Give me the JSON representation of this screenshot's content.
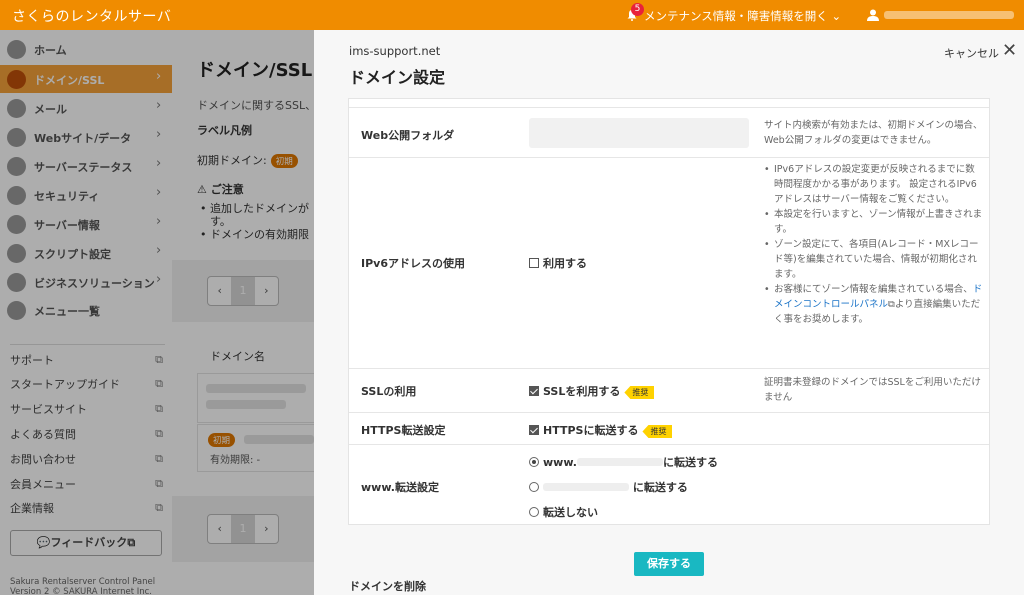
{
  "topbar": {
    "brand": "さくらのレンタルサーバ",
    "notification_count": "5",
    "maintenance_label": "メンテナンス情報・障害情報を開く"
  },
  "sidebar": {
    "items": [
      {
        "label": "ホーム",
        "icon": "home-icon"
      },
      {
        "label": "ドメイン/SSL",
        "icon": "domain-icon"
      },
      {
        "label": "メール",
        "icon": "mail-icon"
      },
      {
        "label": "Webサイト/データ",
        "icon": "globe-icon"
      },
      {
        "label": "サーバーステータス",
        "icon": "chart-icon"
      },
      {
        "label": "セキュリティ",
        "icon": "lock-icon"
      },
      {
        "label": "サーバー情報",
        "icon": "server-icon"
      },
      {
        "label": "スクリプト設定",
        "icon": "script-icon"
      },
      {
        "label": "ビジネスソリューション",
        "icon": "gear-icon"
      },
      {
        "label": "メニュー一覧",
        "icon": "list-icon"
      }
    ],
    "links": [
      "サポート",
      "スタートアップガイド",
      "サービスサイト",
      "よくある質問",
      "お問い合わせ",
      "会員メニュー",
      "企業情報"
    ],
    "feedback_label": "フィードバック",
    "footer_line1": "Sakura Rentalserver Control Panel",
    "footer_line2": "Version 2 © SAKURA Internet Inc."
  },
  "main": {
    "title": "ドメイン/SSL",
    "desc": "ドメインに関するSSL、",
    "legend_title": "ラベル凡例",
    "legend_initial_label": "初期ドメイン:",
    "badge_initial": "初期",
    "caution_title": "ご注意",
    "caution_item1": "追加したドメインが",
    "caution_item1b": "す。",
    "caution_item2": "ドメインの有効期限",
    "page_prev": "‹",
    "page_current": "1",
    "page_next": "›",
    "domain_column": "ドメイン名",
    "expiry_label": "有効期限: -"
  },
  "panel": {
    "domain": "ims-support.net",
    "title": "ドメイン設定",
    "cancel_label": "キャンセル",
    "web_folder_label": "Web公開フォルダ",
    "web_folder_note": "サイト内検索が有効または、初期ドメインの場合、Web公開フォルダの変更はできません。",
    "ipv6_label": "IPv6アドレスの使用",
    "ipv6_checkbox": "利用する",
    "ipv6_notes": [
      "IPv6アドレスの設定変更が反映されるまでに数時間程度かかる事があります。 設定されるIPv6アドレスはサーバー情報をご覧ください。",
      "本設定を行いますと、ゾーン情報が上書きされます。",
      "ゾーン設定にて、各項目(Aレコード・MXレコード等)を編集されていた場合、情報が初期化されます。"
    ],
    "ipv6_note4_pre": "お客様にてゾーン情報を編集されている場合、",
    "ipv6_note4_link": "ドメインコントロールパネル",
    "ipv6_note4_post": "より直接編集いただく事をお奨めします。",
    "ssl_label": "SSLの利用",
    "ssl_checkbox": "SSLを利用する",
    "recommended": "推奨",
    "ssl_note": "証明書未登録のドメインではSSLをご利用いただけません",
    "https_label": "HTTPS転送設定",
    "https_checkbox": "HTTPSに転送する",
    "www_label": "www.転送設定",
    "www_option1_prefix": "www.",
    "www_option1_suffix": "に転送する",
    "www_option2_suffix": "に転送する",
    "www_option3": "転送しない",
    "save_label": "保存する",
    "delete_title": "ドメインを削除"
  }
}
